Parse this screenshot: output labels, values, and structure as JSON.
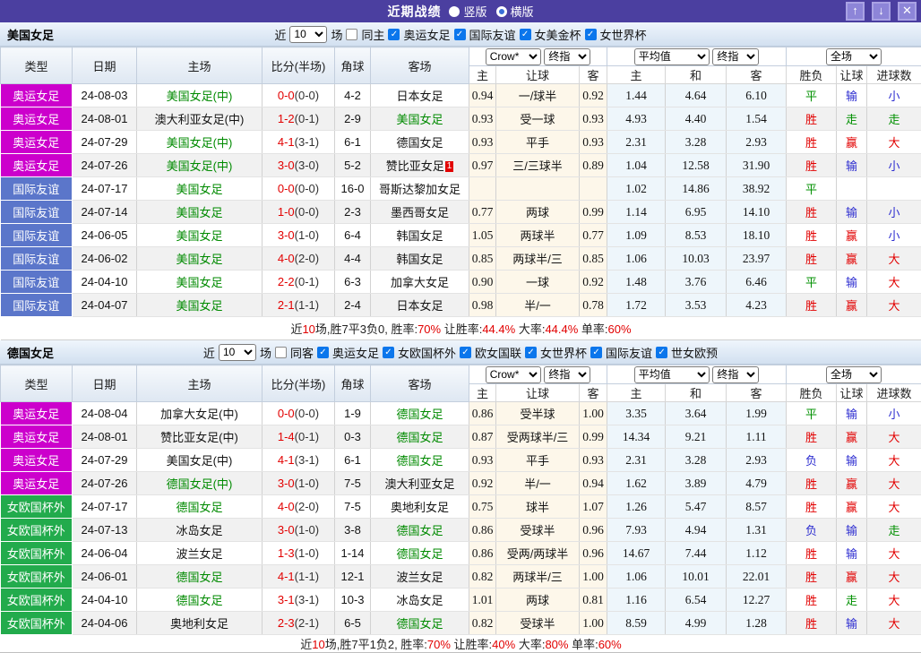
{
  "title_bar": {
    "title": "近期战绩",
    "radios": [
      {
        "label": "竖版",
        "selected": true
      },
      {
        "label": "横版",
        "selected": false
      }
    ],
    "icons": {
      "up": "↑",
      "down": "↓",
      "close": "✕"
    }
  },
  "columns": {
    "main": [
      "类型",
      "日期",
      "主场",
      "比分(半场)",
      "角球",
      "客场"
    ],
    "sub": [
      "主",
      "让球",
      "客",
      "主",
      "和",
      "客",
      "胜负",
      "让球",
      "进球数"
    ]
  },
  "colors": {
    "type_bg": {
      "奥运女足": "#cc00cc",
      "国际友谊": "#5b76ca",
      "女欧国杯外": "#22ab4c"
    },
    "result": {
      "胜": "c-red",
      "平": "c-green",
      "负": "c-blue",
      "赢": "c-red",
      "输": "c-blue",
      "走": "c-green",
      "大": "c-red",
      "小": "c-blue"
    }
  },
  "row_fields": [
    "type",
    "date",
    "home",
    "home_focus",
    "score_ft",
    "score_ht",
    "corner",
    "away",
    "away_focus",
    "away_badge",
    "let_home",
    "let_line",
    "let_away",
    "euro_home",
    "euro_draw",
    "euro_away",
    "res_wdl",
    "res_let",
    "res_goal"
  ],
  "sections": [
    {
      "team": "美国女足",
      "filter": {
        "near": "近",
        "count": "10",
        "games": "场",
        "checkboxes": [
          {
            "label": "同主",
            "checked": false
          },
          {
            "label": "奥运女足",
            "checked": true
          },
          {
            "label": "国际友谊",
            "checked": true
          },
          {
            "label": "女美金杯",
            "checked": true
          },
          {
            "label": "女世界杯",
            "checked": true
          }
        ]
      },
      "selects": {
        "let_source": "Crow*",
        "let_time": "终指",
        "euro_source": "平均值",
        "euro_time": "终指",
        "scope": "全场"
      },
      "rows": [
        [
          "奥运女足",
          "24-08-03",
          "美国女足(中)",
          1,
          "0-0",
          "(0-0)",
          "4-2",
          "日本女足",
          0,
          "",
          "0.94",
          "一/球半",
          "0.92",
          "1.44",
          "4.64",
          "6.10",
          "平",
          "输",
          "小"
        ],
        [
          "奥运女足",
          "24-08-01",
          "澳大利亚女足(中)",
          0,
          "1-2",
          "(0-1)",
          "2-9",
          "美国女足",
          1,
          "",
          "0.93",
          "受一球",
          "0.93",
          "4.93",
          "4.40",
          "1.54",
          "胜",
          "走",
          "走"
        ],
        [
          "奥运女足",
          "24-07-29",
          "美国女足(中)",
          1,
          "4-1",
          "(3-1)",
          "6-1",
          "德国女足",
          0,
          "",
          "0.93",
          "平手",
          "0.93",
          "2.31",
          "3.28",
          "2.93",
          "胜",
          "赢",
          "大"
        ],
        [
          "奥运女足",
          "24-07-26",
          "美国女足(中)",
          1,
          "3-0",
          "(3-0)",
          "5-2",
          "赞比亚女足",
          0,
          "1",
          "0.97",
          "三/三球半",
          "0.89",
          "1.04",
          "12.58",
          "31.90",
          "胜",
          "输",
          "小"
        ],
        [
          "国际友谊",
          "24-07-17",
          "美国女足",
          1,
          "0-0",
          "(0-0)",
          "16-0",
          "哥斯达黎加女足",
          0,
          "",
          "",
          "",
          "",
          "1.02",
          "14.86",
          "38.92",
          "平",
          "",
          ""
        ],
        [
          "国际友谊",
          "24-07-14",
          "美国女足",
          1,
          "1-0",
          "(0-0)",
          "2-3",
          "墨西哥女足",
          0,
          "",
          "0.77",
          "两球",
          "0.99",
          "1.14",
          "6.95",
          "14.10",
          "胜",
          "输",
          "小"
        ],
        [
          "国际友谊",
          "24-06-05",
          "美国女足",
          1,
          "3-0",
          "(1-0)",
          "6-4",
          "韩国女足",
          0,
          "",
          "1.05",
          "两球半",
          "0.77",
          "1.09",
          "8.53",
          "18.10",
          "胜",
          "赢",
          "小"
        ],
        [
          "国际友谊",
          "24-06-02",
          "美国女足",
          1,
          "4-0",
          "(2-0)",
          "4-4",
          "韩国女足",
          0,
          "",
          "0.85",
          "两球半/三",
          "0.85",
          "1.06",
          "10.03",
          "23.97",
          "胜",
          "赢",
          "大"
        ],
        [
          "国际友谊",
          "24-04-10",
          "美国女足",
          1,
          "2-2",
          "(0-1)",
          "6-3",
          "加拿大女足",
          0,
          "",
          "0.90",
          "一球",
          "0.92",
          "1.48",
          "3.76",
          "6.46",
          "平",
          "输",
          "大"
        ],
        [
          "国际友谊",
          "24-04-07",
          "美国女足",
          1,
          "2-1",
          "(1-1)",
          "2-4",
          "日本女足",
          0,
          "",
          "0.98",
          "半/一",
          "0.78",
          "1.72",
          "3.53",
          "4.23",
          "胜",
          "赢",
          "大"
        ]
      ],
      "summary": [
        [
          "近",
          0
        ],
        [
          "10",
          1
        ],
        [
          "场,胜7平3负0, 胜率:",
          0
        ],
        [
          "70%",
          1
        ],
        [
          " 让胜率:",
          0
        ],
        [
          "44.4%",
          1
        ],
        [
          " 大率:",
          0
        ],
        [
          "44.4%",
          1
        ],
        [
          " 单率:",
          0
        ],
        [
          "60%",
          1
        ]
      ]
    },
    {
      "team": "德国女足",
      "filter": {
        "near": "近",
        "count": "10",
        "games": "场",
        "checkboxes": [
          {
            "label": "同客",
            "checked": false
          },
          {
            "label": "奥运女足",
            "checked": true
          },
          {
            "label": "女欧国杯外",
            "checked": true
          },
          {
            "label": "欧女国联",
            "checked": true
          },
          {
            "label": "女世界杯",
            "checked": true
          },
          {
            "label": "国际友谊",
            "checked": true
          },
          {
            "label": "世女欧预",
            "checked": true
          }
        ]
      },
      "selects": {
        "let_source": "Crow*",
        "let_time": "终指",
        "euro_source": "平均值",
        "euro_time": "终指",
        "scope": "全场"
      },
      "rows": [
        [
          "奥运女足",
          "24-08-04",
          "加拿大女足(中)",
          0,
          "0-0",
          "(0-0)",
          "1-9",
          "德国女足",
          1,
          "",
          "0.86",
          "受半球",
          "1.00",
          "3.35",
          "3.64",
          "1.99",
          "平",
          "输",
          "小"
        ],
        [
          "奥运女足",
          "24-08-01",
          "赞比亚女足(中)",
          0,
          "1-4",
          "(0-1)",
          "0-3",
          "德国女足",
          1,
          "",
          "0.87",
          "受两球半/三",
          "0.99",
          "14.34",
          "9.21",
          "1.11",
          "胜",
          "赢",
          "大"
        ],
        [
          "奥运女足",
          "24-07-29",
          "美国女足(中)",
          0,
          "4-1",
          "(3-1)",
          "6-1",
          "德国女足",
          1,
          "",
          "0.93",
          "平手",
          "0.93",
          "2.31",
          "3.28",
          "2.93",
          "负",
          "输",
          "大"
        ],
        [
          "奥运女足",
          "24-07-26",
          "德国女足(中)",
          1,
          "3-0",
          "(1-0)",
          "7-5",
          "澳大利亚女足",
          0,
          "",
          "0.92",
          "半/一",
          "0.94",
          "1.62",
          "3.89",
          "4.79",
          "胜",
          "赢",
          "大"
        ],
        [
          "女欧国杯外",
          "24-07-17",
          "德国女足",
          1,
          "4-0",
          "(2-0)",
          "7-5",
          "奥地利女足",
          0,
          "",
          "0.75",
          "球半",
          "1.07",
          "1.26",
          "5.47",
          "8.57",
          "胜",
          "赢",
          "大"
        ],
        [
          "女欧国杯外",
          "24-07-13",
          "冰岛女足",
          0,
          "3-0",
          "(1-0)",
          "3-8",
          "德国女足",
          1,
          "",
          "0.86",
          "受球半",
          "0.96",
          "7.93",
          "4.94",
          "1.31",
          "负",
          "输",
          "走"
        ],
        [
          "女欧国杯外",
          "24-06-04",
          "波兰女足",
          0,
          "1-3",
          "(1-0)",
          "1-14",
          "德国女足",
          1,
          "",
          "0.86",
          "受两/两球半",
          "0.96",
          "14.67",
          "7.44",
          "1.12",
          "胜",
          "输",
          "大"
        ],
        [
          "女欧国杯外",
          "24-06-01",
          "德国女足",
          1,
          "4-1",
          "(1-1)",
          "12-1",
          "波兰女足",
          0,
          "",
          "0.82",
          "两球半/三",
          "1.00",
          "1.06",
          "10.01",
          "22.01",
          "胜",
          "赢",
          "大"
        ],
        [
          "女欧国杯外",
          "24-04-10",
          "德国女足",
          1,
          "3-1",
          "(3-1)",
          "10-3",
          "冰岛女足",
          0,
          "",
          "1.01",
          "两球",
          "0.81",
          "1.16",
          "6.54",
          "12.27",
          "胜",
          "走",
          "大"
        ],
        [
          "女欧国杯外",
          "24-04-06",
          "奥地利女足",
          0,
          "2-3",
          "(2-1)",
          "6-5",
          "德国女足",
          1,
          "",
          "0.82",
          "受球半",
          "1.00",
          "8.59",
          "4.99",
          "1.28",
          "胜",
          "输",
          "大"
        ]
      ],
      "summary": [
        [
          "近",
          0
        ],
        [
          "10",
          1
        ],
        [
          "场,胜7平1负2, 胜率:",
          0
        ],
        [
          "70%",
          1
        ],
        [
          " 让胜率:",
          0
        ],
        [
          "40%",
          1
        ],
        [
          " 大率:",
          0
        ],
        [
          "80%",
          1
        ],
        [
          " 单率:",
          0
        ],
        [
          "60%",
          1
        ]
      ]
    }
  ]
}
